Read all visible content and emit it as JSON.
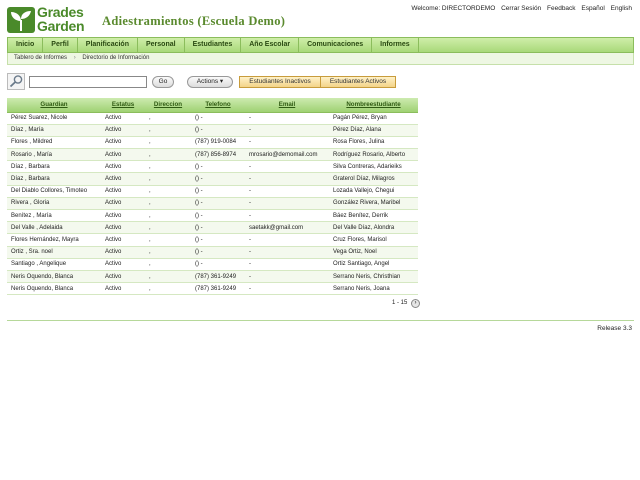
{
  "brand": {
    "logo_line1": "Grades",
    "logo_line2": "Garden"
  },
  "title": "Adiestramientos (Escuela Demo)",
  "top_links": [
    "Welcome: DIRECTORDEMO",
    "Cerrar Sesión",
    "Feedback",
    "Español",
    "English"
  ],
  "nav": [
    "Inicio",
    "Perfil",
    "Planificación",
    "Personal",
    "Estudiantes",
    "Año Escolar",
    "Comunicaciones",
    "Informes"
  ],
  "breadcrumb": [
    "Tablero de Informes",
    "Directorio de Información"
  ],
  "toolbar": {
    "search_placeholder": "",
    "go_label": "Go",
    "actions_label": "Actions ▾",
    "inactive_label": "Estudiantes Inactivos",
    "active_label": "Estudiantes Activos"
  },
  "table": {
    "headers": [
      "Guardian",
      "Estatus",
      "Direccion",
      "Telefono",
      "Email",
      "Nombreestudiante"
    ],
    "rows": [
      [
        "Pérez Suarez, Nicole",
        "Activo",
        ",",
        "() -",
        "-",
        "Pagán Pérez, Bryan"
      ],
      [
        "Díaz , María",
        "Activo",
        ",",
        "() -",
        "-",
        "Pérez Díaz, Alana"
      ],
      [
        "Flores , Mildred",
        "Activo",
        ",",
        "(787) 919-0084",
        "-",
        "Rosa Flores, Julina"
      ],
      [
        "Rosario , María",
        "Activo",
        ",",
        "(787) 856-8974",
        "mrosario@demomail.com",
        "Rodríguez Rosario, Alberto"
      ],
      [
        "Díaz , Barbara",
        "Activo",
        ",",
        "() -",
        "-",
        "Silva Contreras, Adarieiks"
      ],
      [
        "Díaz , Barbara",
        "Activo",
        ",",
        "() -",
        "-",
        "Graterol Díaz, Milagros"
      ],
      [
        "Del Diablo Collores, Timoteo",
        "Activo",
        ",",
        "() -",
        "-",
        "Lozada Vallejo, Chegui"
      ],
      [
        "Rivera , Gloria",
        "Activo",
        ",",
        "() -",
        "-",
        "González Rivera, Maribel"
      ],
      [
        "Benítez , María",
        "Activo",
        ",",
        "() -",
        "-",
        "Báez Benítez, Derrik"
      ],
      [
        "Del Valle , Adelaida",
        "Activo",
        ",",
        "() -",
        "saetakk@gmail.com",
        "Del Valle Díaz, Alondra"
      ],
      [
        "Flores Hernández, Mayra",
        "Activo",
        ",",
        "() -",
        "-",
        "Cruz Flores, Marisol"
      ],
      [
        "Ortiz , Sra. noel",
        "Activo",
        ",",
        "() -",
        "-",
        "Vega Ortiz, Noel"
      ],
      [
        "Santiago , Angelique",
        "Activo",
        ",",
        "() -",
        "-",
        "Ortiz Santiago, Angel"
      ],
      [
        "Neris Oquendo, Blanca",
        "Activo",
        ",",
        "(787) 361-9249",
        "-",
        "Serrano Neris, Christhian"
      ],
      [
        "Neris Oquendo, Blanca",
        "Activo",
        ",",
        "(787) 361-9249",
        "-",
        "Serrano Neris, Joana"
      ]
    ]
  },
  "pager": {
    "range": "1 - 15"
  },
  "footer": {
    "release": "Release 3.3"
  },
  "colors": {
    "accent": "#5a8a2e",
    "nav_bg": "#b6e08a",
    "tab_bg": "#f3d389"
  }
}
